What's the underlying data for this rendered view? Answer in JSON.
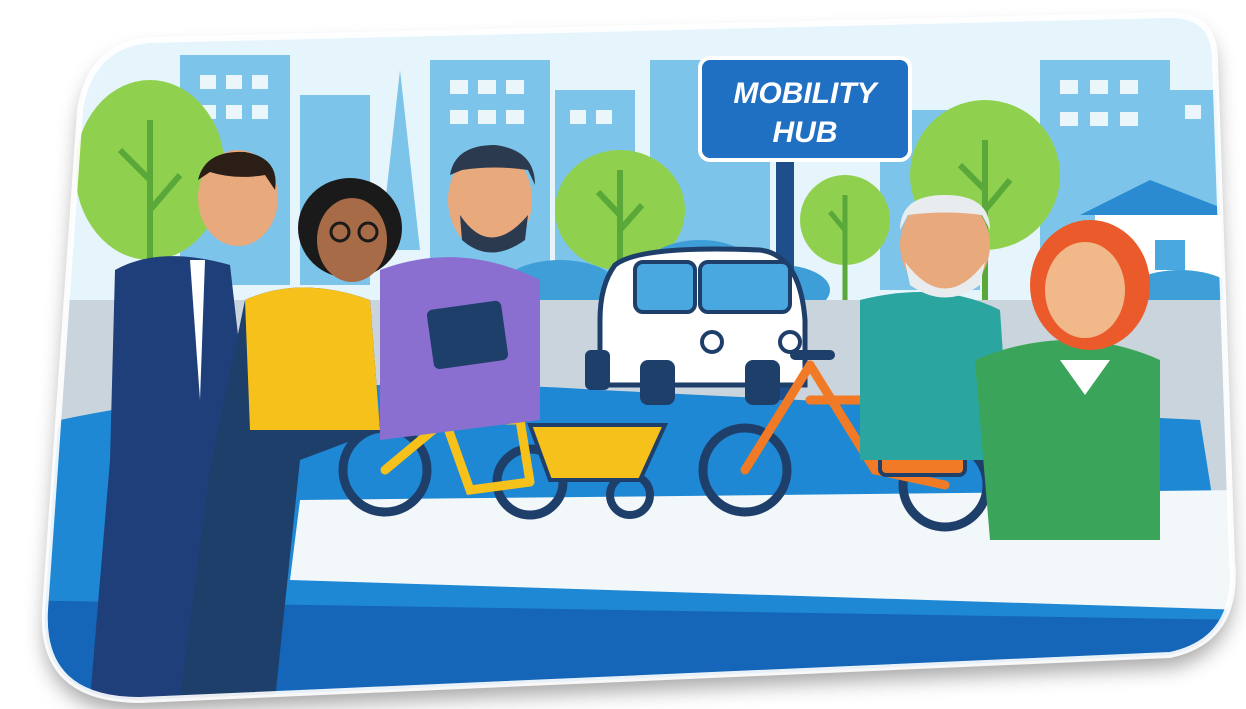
{
  "sign": {
    "line1": "MOBILITY",
    "line2": "HUB"
  },
  "colors": {
    "sky": "#e6f4fb",
    "buildings": "#7cc4ea",
    "tree": "#8fd14f",
    "sign_blue": "#1f6fc2",
    "ground_blue": "#1e88d4",
    "pavement": "#f2f7f9",
    "yellow_bike": "#f7c11b",
    "orange_bike": "#f07a25"
  },
  "icons": [
    "cargo-bike-icon",
    "e-bike-icon",
    "microcar-icon",
    "tablet-icon"
  ]
}
